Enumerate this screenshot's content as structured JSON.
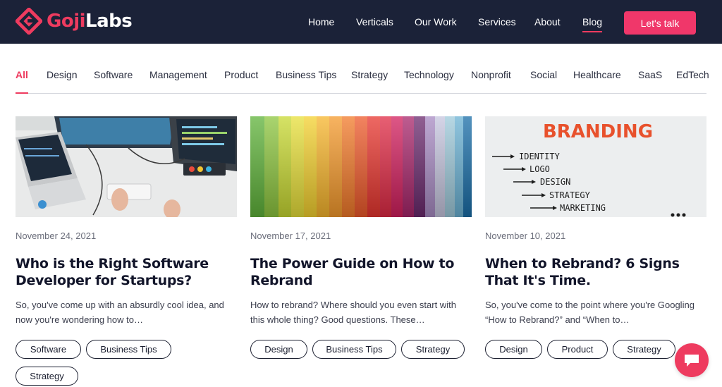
{
  "brand": {
    "goji": "Goji",
    "labs": "Labs"
  },
  "nav": {
    "items": [
      "Home",
      "Verticals",
      "Our Work",
      "Services",
      "About",
      "Blog"
    ],
    "active": "Blog",
    "cta": "Let's talk"
  },
  "categories": [
    "All",
    "Design",
    "Software",
    "Management",
    "Product",
    "Business Tips",
    "Strategy",
    "Technology",
    "Nonprofit",
    "Social",
    "Healthcare",
    "SaaS",
    "EdTech"
  ],
  "active_category": "All",
  "posts": [
    {
      "date": "November 24, 2021",
      "title": "Who is the Right Software Developer for Startups?",
      "excerpt": "So, you've come up with an absurdly cool idea, and now you're wondering how to…",
      "tags": [
        "Software",
        "Business Tips",
        "Strategy"
      ],
      "image": "desk-workspace-photo"
    },
    {
      "date": "November 17, 2021",
      "title": "The Power Guide on How to Rebrand",
      "excerpt": "How to rebrand? Where should you even start with this whole thing?  Good questions. These…",
      "tags": [
        "Design",
        "Business Tips",
        "Strategy"
      ],
      "image": "color-swatch-photo"
    },
    {
      "date": "November 10, 2021",
      "title": "When to Rebrand? 6 Signs That It's Time.",
      "excerpt": "So, you've come to the point where you're Googling “How to Rebrand?” and “When to…",
      "tags": [
        "Design",
        "Product",
        "Strategy"
      ],
      "image": "branding-whiteboard-photo",
      "image_text": {
        "heading": "BRANDING",
        "items": [
          "IDENTITY",
          "LOGO",
          "DESIGN",
          "STRATEGY",
          "MARKETING"
        ]
      }
    }
  ],
  "colors": {
    "navy": "#1b2238",
    "accent": "#ee3b5f",
    "cta": "#f0376a"
  },
  "icons": {
    "logo": "gojilabs-diamond-icon",
    "chat": "chat-bubble-icon"
  }
}
